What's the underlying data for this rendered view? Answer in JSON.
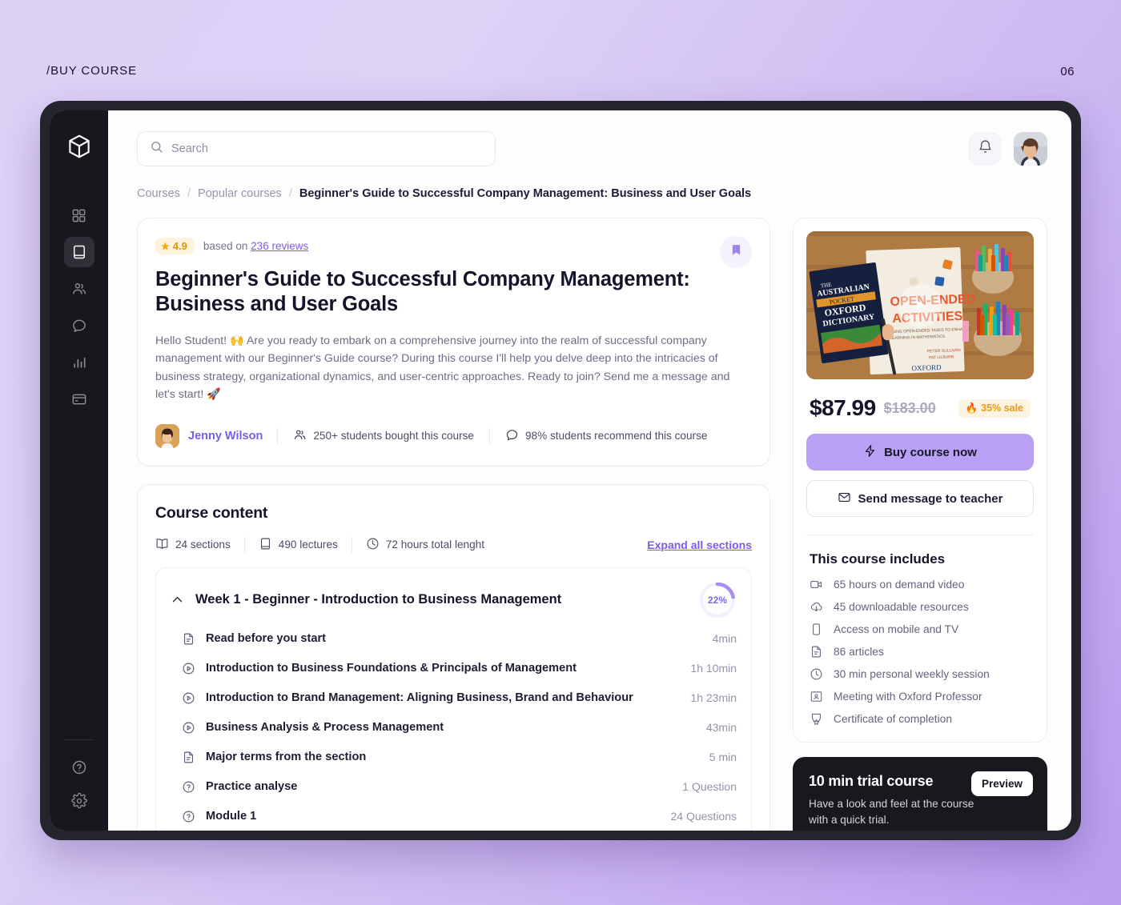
{
  "slide": {
    "label": "/BUY COURSE",
    "number": "06"
  },
  "rail": {
    "logo_icon": "cube-logo-icon",
    "items": [
      {
        "icon": "grid-dashboard-icon",
        "name": "dashboard",
        "active": false
      },
      {
        "icon": "book-icon",
        "name": "courses",
        "active": true
      },
      {
        "icon": "users-icon",
        "name": "community",
        "active": false
      },
      {
        "icon": "chat-bubble-icon",
        "name": "messages",
        "active": false
      },
      {
        "icon": "bar-chart-icon",
        "name": "statistics",
        "active": false
      },
      {
        "icon": "credit-card-icon",
        "name": "billing",
        "active": false
      }
    ],
    "bottom": [
      {
        "icon": "help-circle-icon",
        "name": "help"
      },
      {
        "icon": "gear-icon",
        "name": "settings"
      }
    ]
  },
  "topbar": {
    "search_placeholder": "Search",
    "search_value": "",
    "search_icon": "search-icon",
    "bell_icon": "bell-icon",
    "avatar": "user-avatar"
  },
  "breadcrumb": [
    {
      "label": "Courses",
      "active": false
    },
    {
      "label": "Popular courses",
      "active": false
    },
    {
      "label": "Beginner's Guide to Successful Company Management: Business and User Goals",
      "active": true
    }
  ],
  "hero": {
    "rating": "4.9",
    "rating_prefix": "based on",
    "reviews_link": "236 reviews",
    "bookmark_icon": "bookmark-icon",
    "title": "Beginner's Guide to Successful Company Management: Business and User Goals",
    "description": "Hello Student! 🙌 Are you ready to embark on a comprehensive journey into the realm of successful company management with our Beginner's Guide course? During this course I'll help you delve deep into the intricacies of business strategy, organizational dynamics, and user-centric approaches. Ready to join? Send me a message and let's start! 🚀",
    "teacher": "Jenny Wilson",
    "students": "250+ students bought this course",
    "recommend": "98% students recommend this course"
  },
  "course_content": {
    "heading": "Course content",
    "stats": [
      {
        "icon": "open-book-icon",
        "label": "24 sections"
      },
      {
        "icon": "book-closed-icon",
        "label": "490 lectures"
      },
      {
        "icon": "clock-icon",
        "label": "72 hours total lenght"
      }
    ],
    "expand_all": "Expand all sections",
    "section": {
      "title": "Week 1 - Beginner - Introduction to Business Management",
      "progress": 22,
      "progress_label": "22%",
      "chevron_icon": "chevron-up-icon",
      "lessons": [
        {
          "icon": "document-icon",
          "title": "Read before you start",
          "duration": "4min"
        },
        {
          "icon": "play-circle-icon",
          "title": "Introduction to Business Foundations & Principals of Management",
          "duration": "1h 10min"
        },
        {
          "icon": "play-circle-icon",
          "title": "Introduction to Brand Management: Aligning Business, Brand and Behaviour",
          "duration": "1h 23min"
        },
        {
          "icon": "play-circle-icon",
          "title": "Business Analysis & Process Management",
          "duration": "43min"
        },
        {
          "icon": "document-icon",
          "title": "Major terms from the section",
          "duration": "5 min"
        },
        {
          "icon": "question-circle-icon",
          "title": "Practice analyse",
          "duration": "1 Question"
        },
        {
          "icon": "question-circle-icon",
          "title": "Module 1",
          "duration": "24 Questions"
        }
      ]
    }
  },
  "buy_panel": {
    "thumbnail_alt": "course-preview-thumbnail",
    "play_icon": "play-icon",
    "price_current": "$87.99",
    "price_original": "$183.00",
    "sale_badge": "35% sale",
    "sale_icon": "🔥",
    "buy_button": "Buy course now",
    "buy_icon": "lightning-bolt-icon",
    "message_button": "Send message to teacher",
    "message_icon": "envelope-icon",
    "includes_heading": "This course includes",
    "includes": [
      {
        "icon": "video-camera-icon",
        "label": "65 hours on demand video"
      },
      {
        "icon": "download-cloud-icon",
        "label": "45 downloadable resources"
      },
      {
        "icon": "mobile-device-icon",
        "label": "Access on mobile and TV"
      },
      {
        "icon": "document-icon",
        "label": "86 articles"
      },
      {
        "icon": "clock-icon",
        "label": "30 min personal weekly session"
      },
      {
        "icon": "presentation-icon",
        "label": "Meeting with Oxford Professor"
      },
      {
        "icon": "certificate-icon",
        "label": "Certificate of completion"
      }
    ]
  },
  "trial": {
    "title": "10 min trial course",
    "description": "Have a look and feel at the course with a quick trial.",
    "preview_button": "Preview"
  },
  "colors": {
    "accent_purple": "#7b5ce8",
    "button_purple": "#b9a0f5",
    "dark": "#17171d",
    "amber": "#e8981a"
  }
}
